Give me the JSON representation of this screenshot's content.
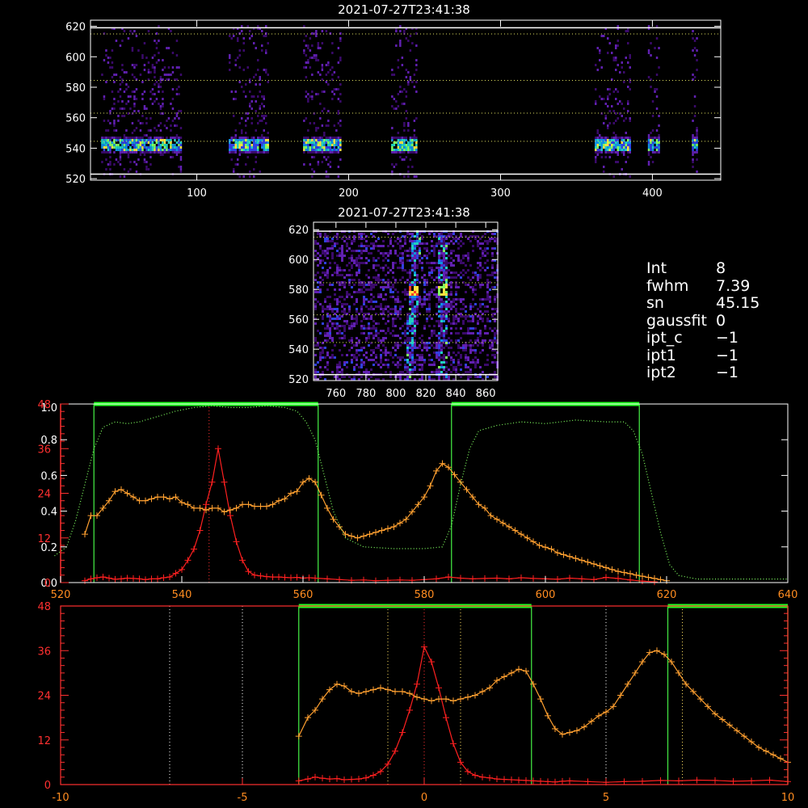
{
  "panels": {
    "top": {
      "title": "2021-07-27T23:41:38",
      "x_ticks": [
        100,
        200,
        300,
        400
      ],
      "x_range": [
        30,
        445
      ],
      "y_ticks": [
        520,
        540,
        560,
        580,
        600,
        620
      ],
      "y_range": [
        519,
        624
      ],
      "white_lines_y": [
        523,
        619
      ],
      "dotted_lines_y": [
        544.5,
        563,
        584.5,
        615
      ],
      "bands": [
        [
          37,
          90
        ],
        [
          121,
          147
        ],
        [
          170,
          195
        ],
        [
          228,
          245
        ],
        [
          362,
          385
        ],
        [
          397,
          404
        ],
        [
          426,
          429
        ]
      ]
    },
    "middle": {
      "title": "2021-07-27T23:41:38",
      "x_ticks": [
        760,
        780,
        800,
        820,
        840,
        860
      ],
      "x_range": [
        745,
        868
      ],
      "y_ticks": [
        520,
        540,
        560,
        580,
        600,
        620
      ],
      "y_range": [
        519,
        625
      ],
      "white_lines_y": [
        523,
        619
      ],
      "dotted_lines_y": [
        544.5,
        563,
        584.5,
        615
      ]
    }
  },
  "info": [
    {
      "key": "Int",
      "value": "8"
    },
    {
      "key": "fwhm",
      "value": "7.39"
    },
    {
      "key": "sn",
      "value": "45.15"
    },
    {
      "key": "gaussfit",
      "value": "0"
    },
    {
      "key": "ipt_c",
      "value": "−1"
    },
    {
      "key": "ipt1",
      "value": "−1"
    },
    {
      "key": "ipt2",
      "value": "−1"
    }
  ],
  "chart_data": [
    {
      "type": "line",
      "x_range": [
        520,
        640
      ],
      "x_ticks": [
        520,
        540,
        560,
        580,
        600,
        620,
        640
      ],
      "y_left_ticks": [
        0.0,
        0.2,
        0.4,
        0.6,
        0.8
      ],
      "y_left_range": [
        0,
        1
      ],
      "y_left_extra_label": "1.0",
      "y_right_ticks": [
        0,
        12,
        24,
        36,
        48
      ],
      "y_right_range": [
        0,
        48
      ],
      "windows": [
        [
          525.5,
          562.5
        ],
        [
          584.5,
          615.5
        ]
      ],
      "center_line_x": 544.5,
      "series": [
        {
          "color": "#ff2020",
          "x": [
            524,
            525,
            526,
            527,
            528,
            529,
            530,
            531,
            532,
            533,
            534,
            535,
            536,
            537,
            538,
            539,
            540,
            541,
            542,
            543,
            544,
            545,
            546,
            547,
            548,
            549,
            550,
            551,
            552,
            553,
            554,
            555,
            556,
            557,
            558,
            559,
            560,
            561,
            562,
            564,
            566,
            568,
            570,
            572,
            574,
            576,
            578,
            580,
            582,
            584,
            586,
            588,
            590,
            592,
            594,
            596,
            598,
            600,
            602,
            604,
            606,
            608,
            610,
            612,
            614,
            616,
            618
          ],
          "y": [
            0.5,
            1,
            1.3,
            1.5,
            1.2,
            0.9,
            1,
            1.2,
            1.1,
            1,
            0.8,
            1,
            1,
            1.3,
            1.5,
            2.5,
            3.5,
            6,
            9,
            14,
            21,
            27,
            36,
            27,
            18,
            11,
            6,
            3,
            2,
            1.8,
            1.6,
            1.5,
            1.5,
            1.4,
            1.3,
            1.4,
            1.2,
            1.3,
            1.2,
            1,
            0.8,
            0.6,
            0.7,
            0.5,
            0.6,
            0.7,
            0.6,
            0.8,
            1,
            1.5,
            1.2,
            1,
            1.1,
            1.2,
            1,
            1.3,
            1.1,
            1,
            0.9,
            1.2,
            1,
            0.8,
            1.4,
            1.1,
            0.7,
            0.4,
            0.2
          ]
        },
        {
          "color": "#ffa030",
          "x": [
            524,
            525,
            526,
            527,
            528,
            529,
            530,
            531,
            532,
            533,
            534,
            535,
            536,
            537,
            538,
            539,
            540,
            541,
            542,
            543,
            544,
            545,
            546,
            547,
            548,
            549,
            550,
            551,
            552,
            553,
            554,
            555,
            556,
            557,
            558,
            559,
            560,
            561,
            562,
            563,
            564,
            565,
            566,
            567,
            568,
            569,
            570,
            571,
            572,
            573,
            574,
            575,
            576,
            577,
            578,
            579,
            580,
            581,
            582,
            583,
            584,
            585,
            586,
            587,
            588,
            589,
            590,
            591,
            592,
            593,
            594,
            595,
            596,
            597,
            598,
            599,
            600,
            601,
            602,
            603,
            604,
            605,
            606,
            607,
            608,
            609,
            610,
            611,
            612,
            613,
            614,
            615,
            616,
            617,
            618,
            619,
            620
          ],
          "y": [
            13,
            18,
            18,
            20,
            22,
            24.5,
            25,
            24,
            23,
            22,
            22,
            22.5,
            23,
            23,
            22.5,
            23,
            21.5,
            21,
            20,
            20,
            19.5,
            20,
            20,
            19,
            19.5,
            20,
            21,
            21,
            20.5,
            20.5,
            20.5,
            21,
            22,
            22.5,
            24,
            24.5,
            27,
            28,
            27,
            23.5,
            20,
            17,
            15,
            13,
            12.5,
            12,
            12.5,
            13,
            13.5,
            14,
            14.5,
            15,
            16,
            17,
            19,
            21,
            23,
            26,
            30,
            32,
            31,
            29,
            27,
            25,
            23,
            21,
            20,
            18,
            17,
            16,
            15,
            14,
            13,
            12,
            11,
            10,
            9.5,
            9,
            8,
            7.5,
            7,
            6.5,
            6,
            5.5,
            5,
            4.5,
            4,
            3.5,
            3,
            2.7,
            2.4,
            2,
            1.7,
            1.4,
            1.1,
            0.8,
            0.5
          ]
        },
        {
          "color": "#80ff60",
          "dotted": true,
          "x": [
            519,
            521,
            522.5,
            524,
            525.5,
            527,
            529,
            531,
            533,
            536,
            539,
            542,
            545,
            548,
            551,
            554,
            557,
            559,
            560.5,
            562,
            563.5,
            565,
            567,
            570,
            575,
            580,
            583,
            584.5,
            586,
            587.5,
            589,
            592,
            596,
            600,
            605,
            610,
            613,
            614.5,
            616,
            617.5,
            619,
            620.5,
            622,
            625,
            630,
            635,
            640
          ],
          "y": [
            0.15,
            0.2,
            0.35,
            0.55,
            0.75,
            0.87,
            0.9,
            0.89,
            0.9,
            0.93,
            0.96,
            0.98,
            0.99,
            0.98,
            0.98,
            0.99,
            0.98,
            0.96,
            0.9,
            0.8,
            0.6,
            0.4,
            0.25,
            0.2,
            0.19,
            0.19,
            0.2,
            0.32,
            0.55,
            0.75,
            0.85,
            0.88,
            0.9,
            0.89,
            0.91,
            0.9,
            0.9,
            0.85,
            0.72,
            0.5,
            0.28,
            0.1,
            0.04,
            0.02,
            0.02,
            0.02,
            0.02
          ]
        }
      ]
    },
    {
      "type": "line",
      "x_range": [
        -10,
        10
      ],
      "x_ticks": [
        -10,
        -5,
        0,
        5,
        10
      ],
      "y_ticks": [
        0,
        12,
        24,
        36,
        48
      ],
      "y_range": [
        0,
        48
      ],
      "windows": [
        [
          -3.45,
          2.95
        ],
        [
          6.7,
          10
        ]
      ],
      "center_line_x": 0,
      "white_dotted_x": [
        -7,
        -5,
        5
      ],
      "yellow_dotted_x": [
        -1,
        1,
        -1.0,
        7.1
      ],
      "series": [
        {
          "color": "#ff2020",
          "x": [
            -3.45,
            -3.2,
            -3,
            -2.8,
            -2.6,
            -2.4,
            -2.2,
            -2,
            -1.8,
            -1.6,
            -1.4,
            -1.2,
            -1,
            -0.8,
            -0.6,
            -0.4,
            -0.2,
            0,
            0.2,
            0.4,
            0.6,
            0.8,
            1,
            1.2,
            1.4,
            1.6,
            1.8,
            2,
            2.2,
            2.4,
            2.6,
            2.8,
            3,
            3.2,
            3.4,
            3.6,
            3.8,
            4,
            4.5,
            5,
            5.5,
            6,
            6.5,
            7,
            7.5,
            8,
            8.5,
            9,
            9.5,
            10
          ],
          "y": [
            1,
            1.5,
            2,
            1.7,
            1.5,
            1.6,
            1.3,
            1.4,
            1.5,
            1.8,
            2.5,
            3.5,
            5.5,
            9,
            14,
            20,
            27,
            37,
            33,
            26,
            18,
            11,
            6,
            3.5,
            2.5,
            2,
            1.8,
            1.5,
            1.4,
            1.3,
            1.2,
            1.1,
            1,
            0.9,
            0.8,
            0.7,
            0.9,
            1,
            0.8,
            0.6,
            0.8,
            0.9,
            1.1,
            1,
            1.2,
            1.1,
            0.9,
            1,
            1.2,
            0.8
          ]
        },
        {
          "color": "#ffa030",
          "x": [
            -3.45,
            -3.2,
            -3,
            -2.8,
            -2.6,
            -2.4,
            -2.2,
            -2,
            -1.8,
            -1.6,
            -1.4,
            -1.2,
            -1,
            -0.8,
            -0.6,
            -0.4,
            -0.2,
            0,
            0.2,
            0.4,
            0.6,
            0.8,
            1,
            1.2,
            1.4,
            1.6,
            1.8,
            2,
            2.2,
            2.4,
            2.6,
            2.8,
            3,
            3.2,
            3.4,
            3.6,
            3.8,
            4,
            4.2,
            4.4,
            4.6,
            4.8,
            5,
            5.2,
            5.4,
            5.6,
            5.8,
            6,
            6.2,
            6.4,
            6.6,
            6.8,
            7,
            7.2,
            7.4,
            7.6,
            7.8,
            8,
            8.2,
            8.4,
            8.6,
            8.8,
            9,
            9.2,
            9.4,
            9.6,
            9.8,
            10
          ],
          "y": [
            13,
            18,
            20,
            23,
            25.5,
            27,
            26.5,
            25,
            24.5,
            25,
            25.5,
            26,
            25.5,
            25,
            25,
            24.5,
            23.5,
            23,
            22.5,
            23,
            23,
            22.5,
            23,
            23.5,
            24,
            25,
            26,
            28,
            29,
            30,
            31,
            30.5,
            27,
            23,
            18.5,
            15,
            13.5,
            14,
            14.5,
            15.5,
            17,
            18.5,
            19.5,
            21,
            24,
            27,
            30,
            33,
            35.5,
            36,
            35,
            33,
            30,
            27,
            25,
            23,
            21,
            19,
            17.5,
            16,
            14.5,
            13,
            11.5,
            10,
            9,
            8,
            7,
            6
          ]
        }
      ]
    }
  ]
}
